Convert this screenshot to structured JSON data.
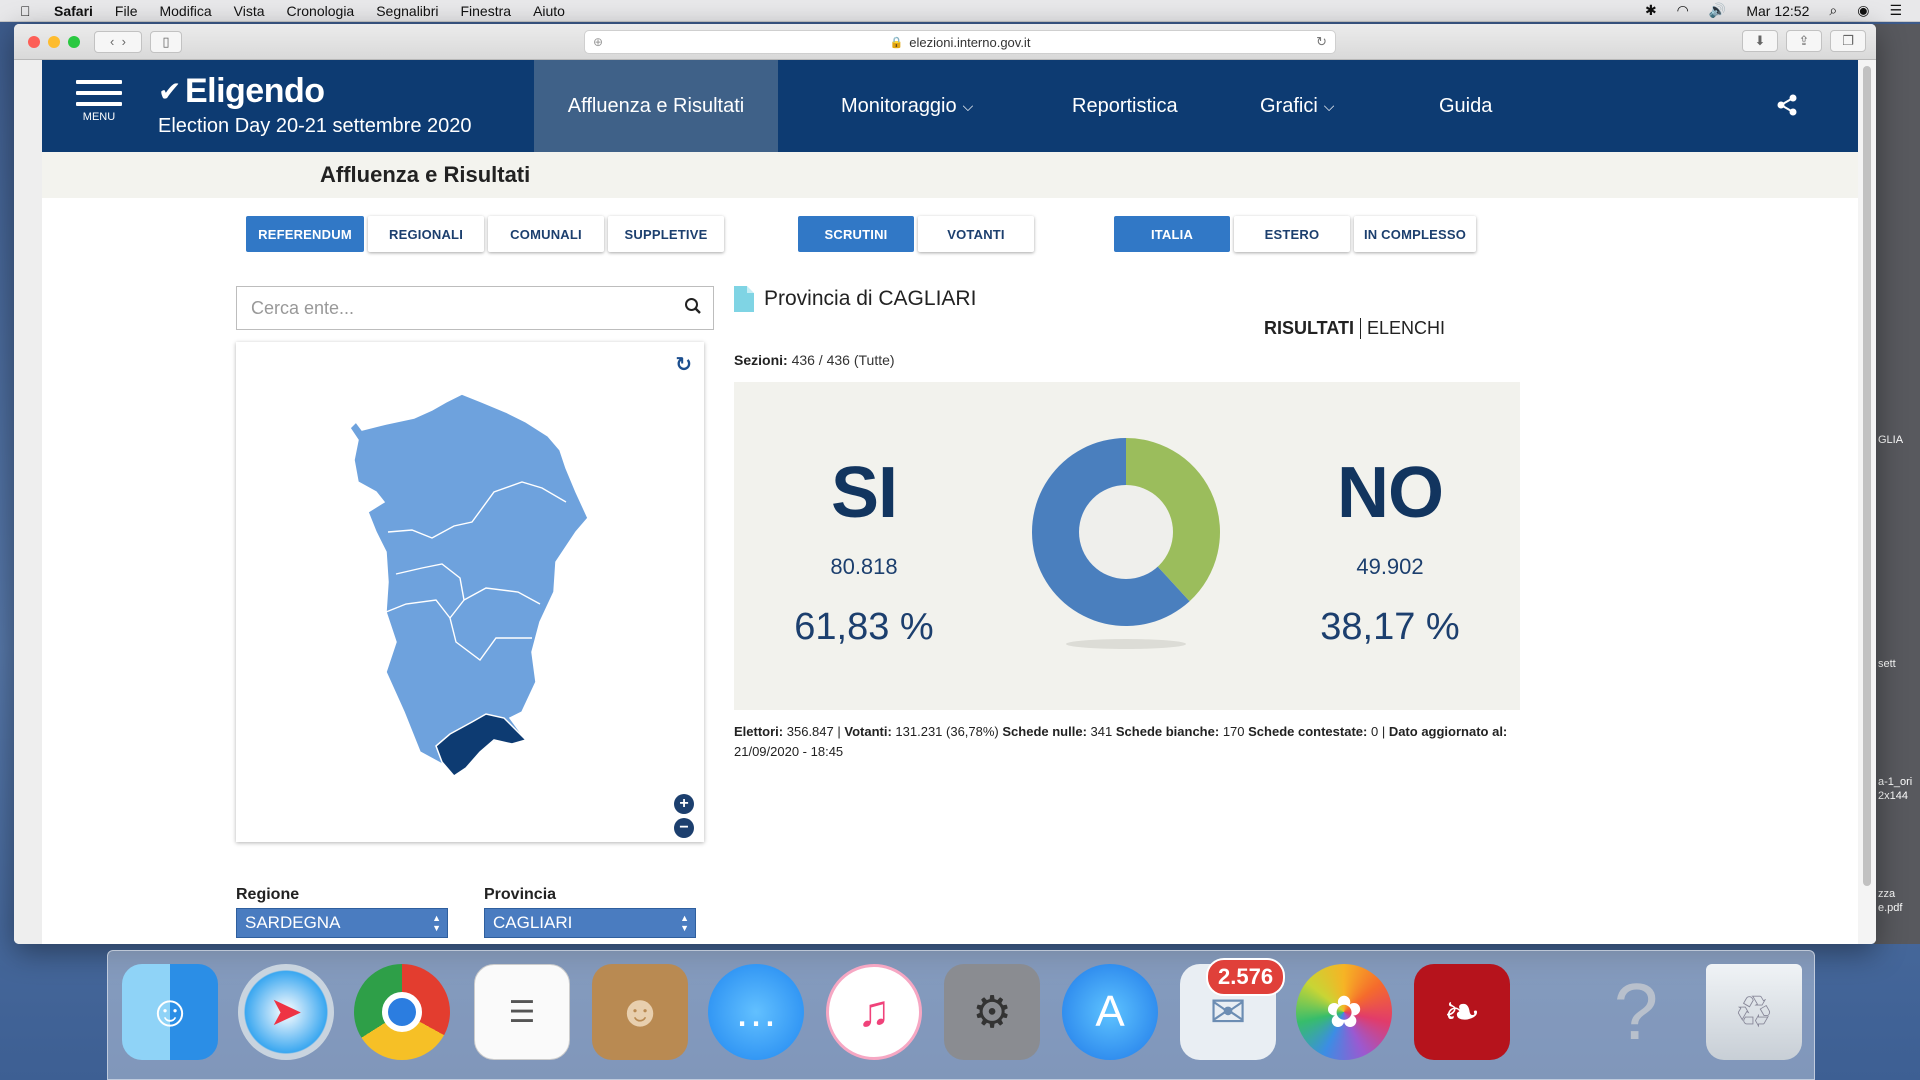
{
  "menubar": {
    "app": "Safari",
    "items": [
      "File",
      "Modifica",
      "Vista",
      "Cronologia",
      "Segnalibri",
      "Finestra",
      "Aiuto"
    ],
    "clock": "Mar 12:52"
  },
  "browser": {
    "url": "elezioni.interno.gov.it"
  },
  "nav": {
    "menu_label": "MENU",
    "brand": "Eligendo",
    "subtitle": "Election Day 20-21 settembre 2020",
    "items": [
      "Affluenza e Risultati",
      "Monitoraggio",
      "Reportistica",
      "Grafici",
      "Guida"
    ]
  },
  "page_title": "Affluenza e Risultati",
  "tabs": {
    "consultation": [
      "REFERENDUM",
      "REGIONALI",
      "COMUNALI",
      "SUPPLETIVE"
    ],
    "mode": [
      "SCRUTINI",
      "VOTANTI"
    ],
    "scope": [
      "ITALIA",
      "ESTERO",
      "IN COMPLESSO"
    ]
  },
  "search": {
    "placeholder": "Cerca ente..."
  },
  "selects": {
    "regione_label": "Regione",
    "regione_value": "SARDEGNA",
    "provincia_label": "Provincia",
    "provincia_value": "CAGLIARI"
  },
  "province_title": "Provincia di CAGLIARI",
  "view_tabs": {
    "risultati": "RISULTATI",
    "elenchi": "ELENCHI"
  },
  "sezioni": {
    "label": "Sezioni:",
    "value": "436 / 436 (Tutte)"
  },
  "results": {
    "si": {
      "label": "SI",
      "votes": "80.818",
      "pct": "61,83 %",
      "share": 61.83,
      "color": "#4a7fbe"
    },
    "no": {
      "label": "NO",
      "votes": "49.902",
      "pct": "38,17 %",
      "share": 38.17,
      "color": "#9bbd5c"
    }
  },
  "footer": {
    "elettori_label": "Elettori:",
    "elettori": "356.847",
    "votanti_label": "Votanti:",
    "votanti": "131.231 (36,78%)",
    "nulle_label": "Schede nulle:",
    "nulle": "341",
    "bianche_label": "Schede bianche:",
    "bianche": "170",
    "contestate_label": "Schede contestate:",
    "contestate": "0",
    "aggiornato_label": "Dato aggiornato al:",
    "aggiornato": "21/09/2020 - 18:45"
  },
  "dock": {
    "mail_badge": "2.576",
    "icons": [
      "finder-icon",
      "safari-icon",
      "chrome-icon",
      "reminders-icon",
      "contacts-icon",
      "messages-icon",
      "itunes-icon",
      "system-preferences-icon",
      "app-store-icon",
      "mail-icon",
      "photos-icon",
      "acrobat-icon",
      "help-icon",
      "trash-icon"
    ]
  },
  "desktop_peek": [
    "GLIA",
    "sett",
    "a-1_ori",
    "2x144",
    "zza",
    "e.pdf"
  ]
}
